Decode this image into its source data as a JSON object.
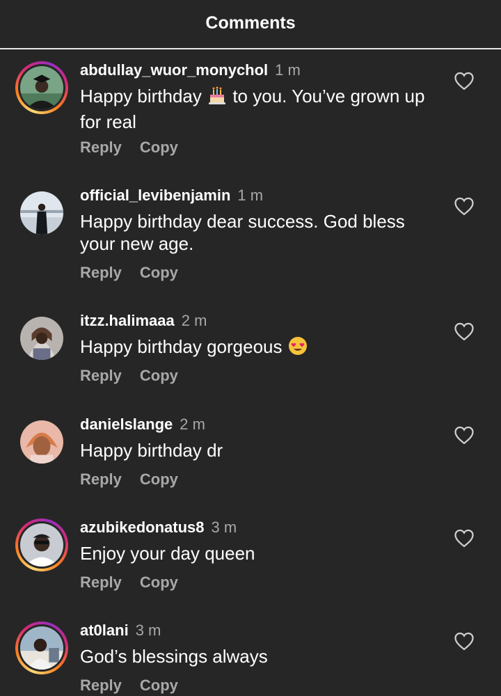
{
  "header": {
    "title": "Comments"
  },
  "actions": {
    "reply_label": "Reply",
    "copy_label": "Copy"
  },
  "comments": [
    {
      "username": "abdullay_wuor_monychol",
      "time": "1 m",
      "text_before": "Happy birthday ",
      "emoji": "birthday-cake-icon",
      "text_after": " to you. You’ve grown up for real",
      "story_ring": true
    },
    {
      "username": "official_levibenjamin",
      "time": "1 m",
      "text": "Happy birthday dear success. God bless your new age.",
      "story_ring": false
    },
    {
      "username": "itzz.halimaaa",
      "time": "2 m",
      "text": "Happy birthday gorgeous",
      "emoji": "heart-eyes-icon",
      "story_ring": false
    },
    {
      "username": "danielslange",
      "time": "2 m",
      "text": "Happy birthday dr",
      "story_ring": false
    },
    {
      "username": "azubikedonatus8",
      "time": "3 m",
      "text": "Enjoy your day queen",
      "story_ring": true
    },
    {
      "username": "at0lani",
      "time": "3 m",
      "text": "God’s blessings always",
      "story_ring": true
    }
  ],
  "colors": {
    "background": "#262626",
    "secondary_text": "#a8a8a8",
    "primary_text": "#ffffff"
  }
}
